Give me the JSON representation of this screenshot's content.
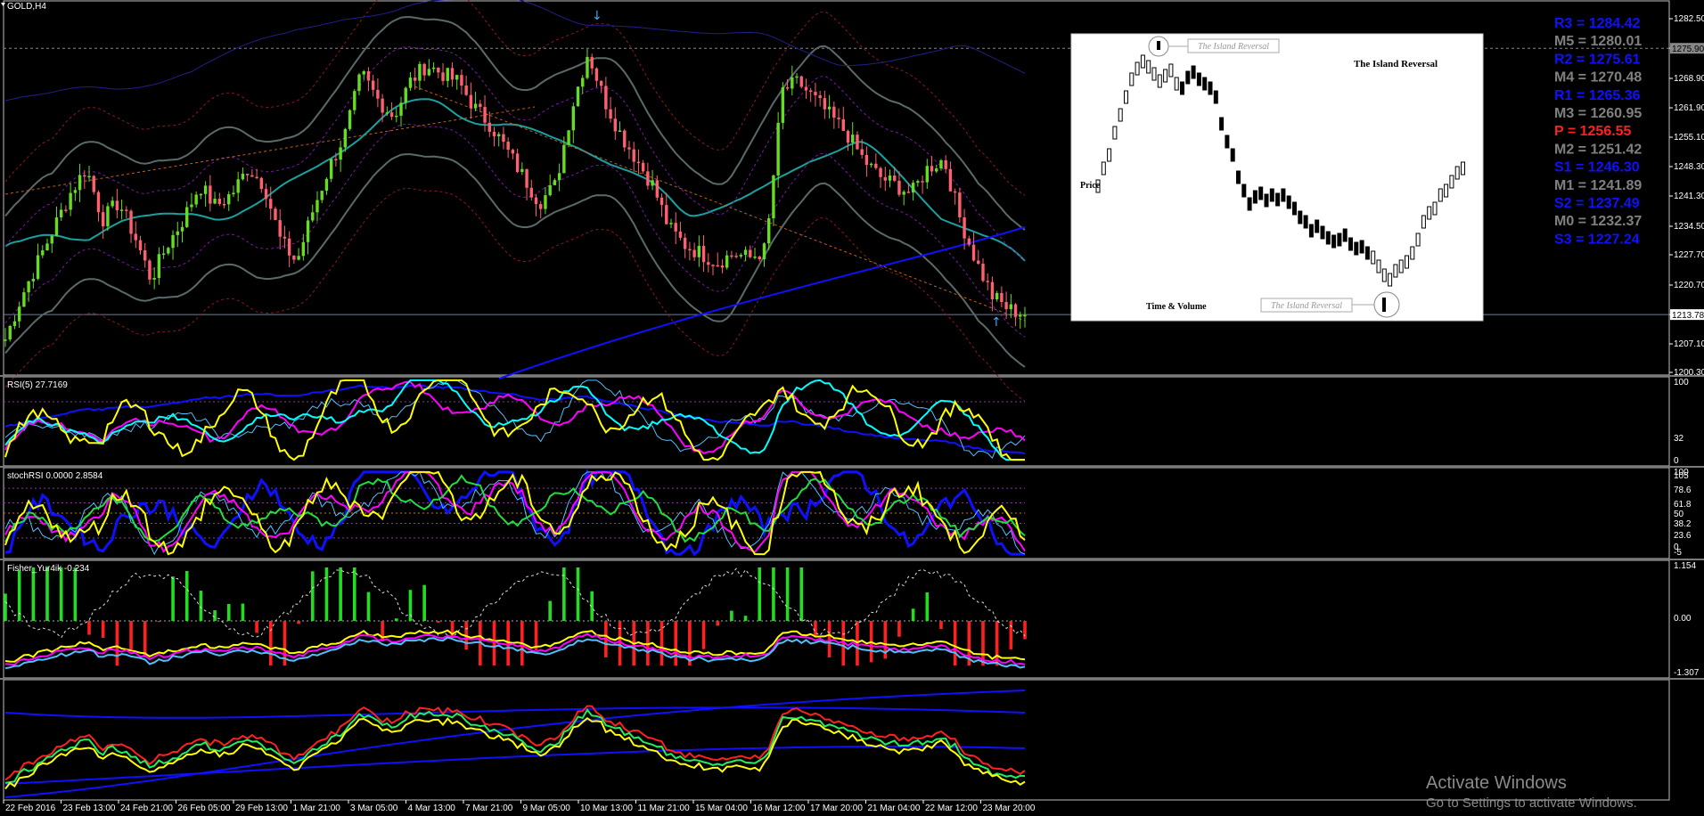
{
  "symbol": "GOLD,H4",
  "price_axis": [
    "1282.50",
    "1275.90",
    "1268.90",
    "1261.90",
    "1255.10",
    "1248.30",
    "1241.30",
    "1234.50",
    "1227.70",
    "1220.70",
    "1213.78",
    "1207.10",
    "1200.30"
  ],
  "bid_label": "1213.78",
  "ask_label": "1275.90",
  "time_axis": [
    "22 Feb 2016",
    "23 Feb 13:00",
    "24 Feb 21:00",
    "26 Feb 05:00",
    "29 Feb 13:00",
    "1 Mar 21:00",
    "3 Mar 05:00",
    "4 Mar 13:00",
    "7 Mar 21:00",
    "9 Mar 05:00",
    "10 Mar 13:00",
    "11 Mar 21:00",
    "15 Mar 04:00",
    "16 Mar 12:00",
    "17 Mar 20:00",
    "21 Mar 04:00",
    "22 Mar 12:00",
    "23 Mar 20:00"
  ],
  "pivots": [
    {
      "text": "R3 = 1284.42",
      "color": "#1010ff"
    },
    {
      "text": "M5 = 1280.01",
      "color": "#808080"
    },
    {
      "text": "R2 = 1275.61",
      "color": "#1010ff"
    },
    {
      "text": "M4 = 1270.48",
      "color": "#808080"
    },
    {
      "text": "R1 = 1265.36",
      "color": "#1010ff"
    },
    {
      "text": "M3 = 1260.95",
      "color": "#808080"
    },
    {
      "text": "P   = 1256.55",
      "color": "#ff2020"
    },
    {
      "text": "M2 = 1251.42",
      "color": "#808080"
    },
    {
      "text": "S1 = 1246.30",
      "color": "#1010ff"
    },
    {
      "text": "M1 = 1241.89",
      "color": "#808080"
    },
    {
      "text": "S2 = 1237.49",
      "color": "#1010ff"
    },
    {
      "text": "M0 = 1232.37",
      "color": "#808080"
    },
    {
      "text": "S3 = 1227.24",
      "color": "#1010ff"
    }
  ],
  "inset": {
    "title": "The Island Reversal",
    "tag_top": "The Island Reversal",
    "tag_bottom": "The Island Reversal",
    "price_label": "Price",
    "time_label": "Time & Volume"
  },
  "panels": {
    "rsi": {
      "title": "RSI(5) 27.7169",
      "levels": [
        "100",
        "32",
        "0"
      ]
    },
    "stoch": {
      "title": "stochRSI 0.0000 2.8584",
      "levels": [
        "100",
        "105",
        "78.6",
        "61.8",
        "50",
        "38.2",
        "23.6",
        "0",
        "-5"
      ]
    },
    "fisher": {
      "title": "Fisher_Yur4ik -0.234",
      "levels": [
        "1.154",
        "0.00",
        "-1.307"
      ]
    }
  },
  "chart_data": {
    "type": "candlestick",
    "title": "GOLD,H4",
    "ylim": [
      1200.3,
      1285.5
    ],
    "x": [
      "22 Feb 2016",
      "23 Feb 13:00",
      "24 Feb 21:00",
      "26 Feb 05:00",
      "29 Feb 13:00",
      "1 Mar 21:00",
      "3 Mar 05:00",
      "4 Mar 13:00",
      "7 Mar 21:00",
      "9 Mar 05:00",
      "10 Mar 13:00",
      "11 Mar 21:00",
      "15 Mar 04:00",
      "16 Mar 12:00",
      "17 Mar 20:00",
      "21 Mar 04:00",
      "22 Mar 12:00",
      "23 Mar 20:00"
    ],
    "close_path": [
      1208,
      1218,
      1226,
      1234,
      1242,
      1248,
      1236,
      1240,
      1232,
      1222,
      1230,
      1236,
      1244,
      1239,
      1242,
      1248,
      1244,
      1231,
      1226,
      1238,
      1248,
      1256,
      1270,
      1264,
      1260,
      1268,
      1272,
      1270,
      1268,
      1262,
      1258,
      1252,
      1246,
      1240,
      1244,
      1262,
      1275,
      1264,
      1256,
      1250,
      1244,
      1234,
      1230,
      1228,
      1226,
      1228,
      1227,
      1229,
      1266,
      1268,
      1264,
      1260,
      1256,
      1250,
      1246,
      1244,
      1242,
      1248,
      1250,
      1236,
      1226,
      1218,
      1215,
      1214
    ]
  },
  "watermark": {
    "line1": "Activate Windows",
    "line2": "Go to Settings to activate Windows."
  }
}
